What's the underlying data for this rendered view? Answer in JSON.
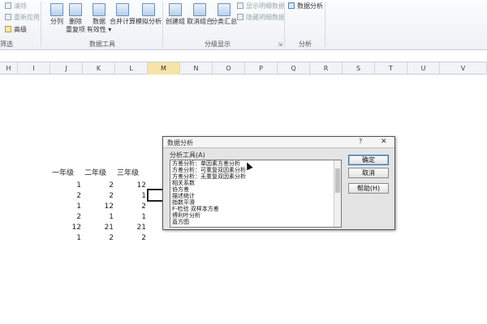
{
  "ribbon": {
    "sort_filter": {
      "items": [
        "清除",
        "重新应用",
        "高级"
      ],
      "group": "筛选"
    },
    "data_tools": {
      "buttons": [
        "分列",
        "删除\n重复项",
        "数据\n有效性",
        "合并计算",
        "模拟分析"
      ],
      "group": "数据工具"
    },
    "outline": {
      "buttons": [
        "创建组",
        "取消组合",
        "分类汇总"
      ],
      "small": [
        "显示明细数据",
        "隐藏明细数据"
      ],
      "group": "分级显示"
    },
    "analysis": {
      "button": "数据分析",
      "group": "分析"
    }
  },
  "columns": [
    "H",
    "I",
    "J",
    "K",
    "L",
    "M",
    "N",
    "O",
    "P",
    "Q",
    "R",
    "S",
    "T",
    "U",
    "V"
  ],
  "selected_column": "M",
  "sheet": {
    "headers": [
      "一年级",
      "二年级",
      "三年级"
    ],
    "rows": [
      [
        "1",
        "2",
        "12"
      ],
      [
        "2",
        "2",
        "1"
      ],
      [
        "1",
        "12",
        "2"
      ],
      [
        "2",
        "1",
        "1"
      ],
      [
        "12",
        "21",
        "21"
      ],
      [
        "1",
        "2",
        "2"
      ]
    ]
  },
  "dialog": {
    "title": "数据分析",
    "help_glyph": "?",
    "close_glyph": "✕",
    "section_label": "分析工具(A)",
    "tools": [
      "方差分析：单因素方差分析",
      "方差分析：可重复双因素分析",
      "方差分析：无重复双因素分析",
      "相关系数",
      "协方差",
      "描述统计",
      "指数平滑",
      "F-检验 双样本方差",
      "傅利叶分析",
      "直方图"
    ],
    "buttons": {
      "ok": "确定",
      "cancel": "取消",
      "help": "帮助(H)"
    }
  }
}
